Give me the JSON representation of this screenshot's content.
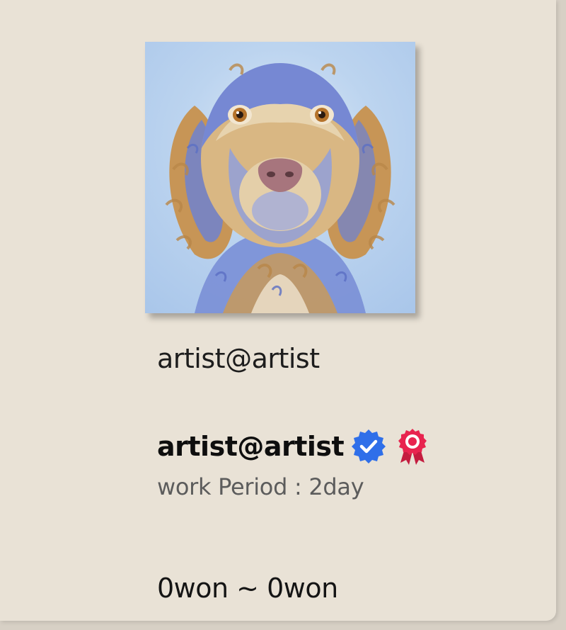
{
  "card": {
    "title": "artist@artist",
    "artist_name": "artist@artist",
    "verified_icon": "verified-check-icon",
    "award_icon": "award-ribbon-icon",
    "work_period": "work Period : 2day",
    "price_range": "0won ~ 0won",
    "artwork_image": "curly-haired-dog-portrait"
  },
  "colors": {
    "background": "#e9e2d6",
    "verified_blue": "#2f6fe9",
    "award_red": "#e8244f"
  }
}
